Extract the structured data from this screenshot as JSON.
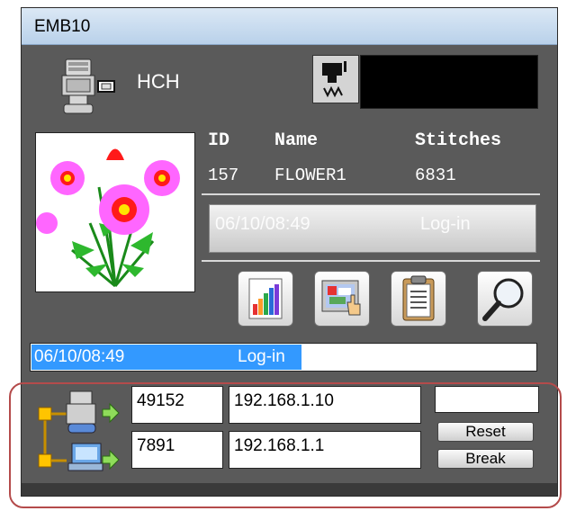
{
  "window": {
    "title": "EMB10"
  },
  "machine": {
    "label": "HCH"
  },
  "design": {
    "columns": [
      "ID",
      "Name",
      "Stitches"
    ],
    "values": [
      "157",
      "FLOWER1",
      "6831"
    ]
  },
  "status_bar": {
    "faded_text": "06/10/08:49",
    "faded_text_right": "Log-in"
  },
  "toolbar": [
    "chart-icon",
    "monitor-pointer-icon",
    "clipboard-icon",
    "magnifier-icon"
  ],
  "log": {
    "timestamp": "06/10/08:49",
    "message": "Log-in"
  },
  "network": {
    "machine_port": "49152",
    "machine_ip": "192.168.1.10",
    "pc_port": "7891",
    "pc_ip": "192.168.1.1"
  },
  "buttons": {
    "reset": "Reset",
    "break": "Break"
  },
  "colors": {
    "highlight": "#3399ff",
    "frame": "#b44b4b",
    "window": "#5a5a5a"
  }
}
